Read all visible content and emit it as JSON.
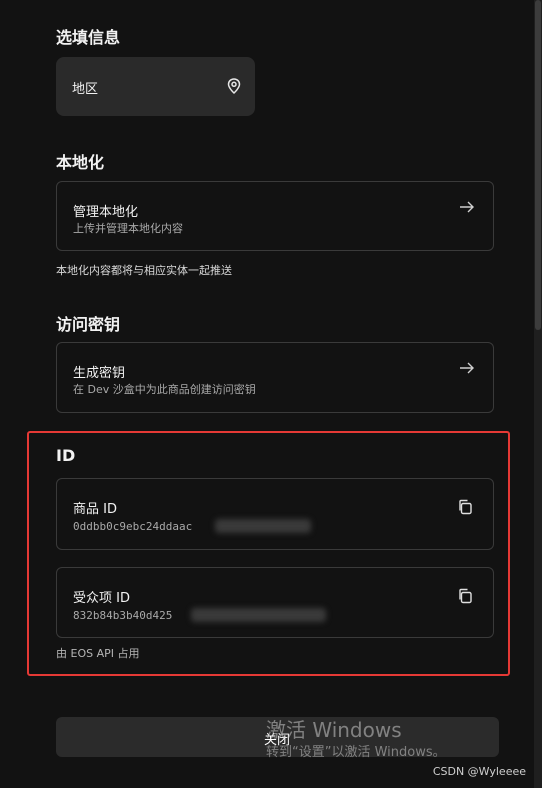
{
  "sections": {
    "optional_info": "选填信息",
    "localization": "本地化",
    "access_key": "访问密钥",
    "id": "ID"
  },
  "region_button": {
    "label": "地区",
    "icon": "location-pin-icon"
  },
  "localization_card": {
    "title": "管理本地化",
    "subtitle": "上传并管理本地化内容",
    "icon": "arrow-right-icon"
  },
  "localization_note": "本地化内容都将与相应实体一起推送",
  "access_key_card": {
    "title": "生成密钥",
    "subtitle": "在 Dev 沙盒中为此商品创建访问密钥",
    "icon": "arrow-right-icon"
  },
  "product_id_card": {
    "title": "商品 ID",
    "value": "0ddbb0c9ebc24ddaac",
    "icon": "copy-icon"
  },
  "audience_id_card": {
    "title": "受众项 ID",
    "value": "832b84b3b40d425",
    "icon": "copy-icon"
  },
  "eos_note": "由 EOS API 占用",
  "close_button": {
    "label": "关闭"
  },
  "watermark": {
    "line1": "激活 Windows",
    "line2": "转到“设置”以激活 Windows。"
  },
  "csdn_tag": "CSDN @Wyleeee",
  "colors": {
    "highlight_border": "#e53935",
    "background": "#121212"
  }
}
